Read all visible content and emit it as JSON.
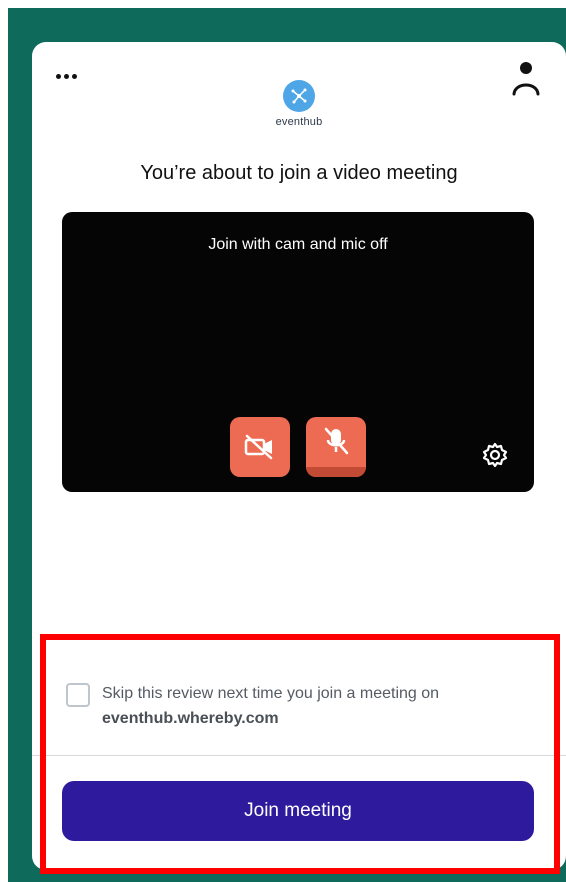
{
  "brand": {
    "name": "eventhub",
    "logo_color": "#4fa6e6"
  },
  "header": {
    "menu_icon": "more-options-icon",
    "profile_icon": "user-icon"
  },
  "main": {
    "title": "You’re about to join a video meeting",
    "video_preview": {
      "label": "Join with cam and mic off",
      "camera_button_icon": "camera-off-icon",
      "mic_button_icon": "mic-off-icon",
      "settings_icon": "gear-icon"
    }
  },
  "footer": {
    "skip_text": "Skip this review next time you join a meeting on",
    "skip_domain": "eventhub.whereby.com",
    "skip_checked": false,
    "join_button_label": "Join meeting"
  },
  "colors": {
    "background_green": "#0e6a5a",
    "accent_orange": "#ee6b53",
    "join_button": "#2e1a9c",
    "highlight_red": "#ff0000"
  }
}
